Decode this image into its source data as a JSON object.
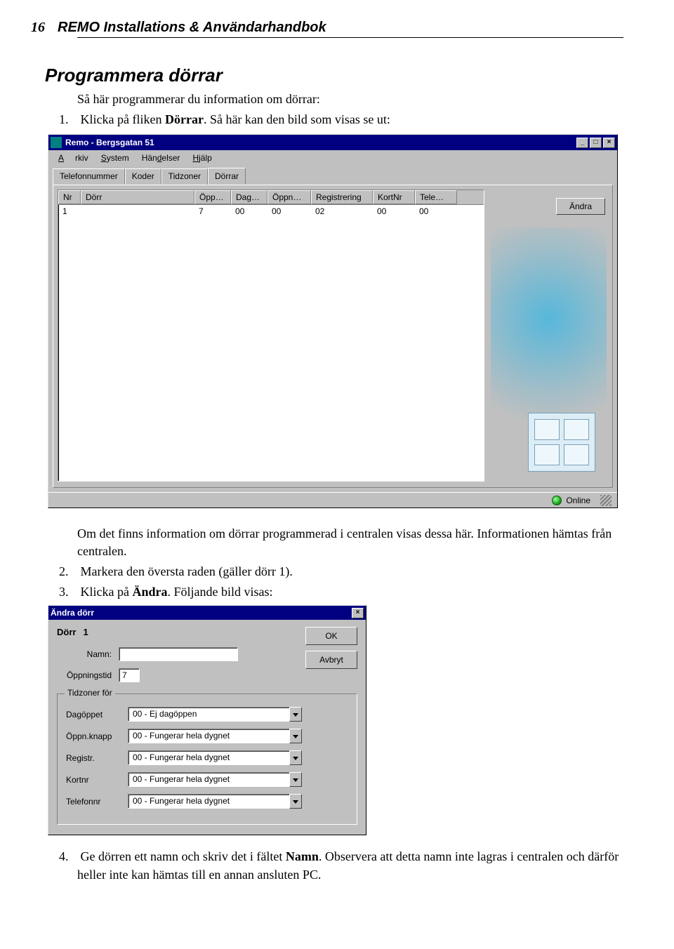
{
  "header": {
    "page_number": "16",
    "doc_title": "REMO Installations & Användarhandbok"
  },
  "section_title": "Programmera dörrar",
  "intro": "Så här programmerar du information om dörrar:",
  "step1_pre": "Klicka på fliken ",
  "step1_bold": "Dörrar",
  "step1_post": ". Så här kan den bild som visas se ut:",
  "win1": {
    "title": "Remo - Bergsgatan 51",
    "menu": {
      "arkiv": "Arkiv",
      "system": "System",
      "handelser": "Händelser",
      "hjalp": "Hjälp"
    },
    "tabs": {
      "telefonnummer": "Telefonnummer",
      "koder": "Koder",
      "tidzoner": "Tidzoner",
      "dorrar": "Dörrar"
    },
    "cols": {
      "nr": "Nr",
      "dorr": "Dörr",
      "opp": "Öpp…",
      "dag": "Dag…",
      "oppn": "Öppn…",
      "reg": "Registrering",
      "kort": "KortNr",
      "tele": "Tele…"
    },
    "row": {
      "nr": "1",
      "dorr": "",
      "opp": "7",
      "dag": "00",
      "oppn": "00",
      "reg": "02",
      "kort": "00",
      "tele": "00"
    },
    "andra": "Ändra",
    "status": "Online"
  },
  "between_text": "Om det finns information om dörrar programmerad i centralen visas dessa här. Informationen hämtas från centralen.",
  "step2": "Markera den översta raden (gäller dörr 1).",
  "step3_pre": "Klicka på ",
  "step3_bold": "Ändra",
  "step3_post": ". Följande bild visas:",
  "dlg": {
    "title": "Ändra dörr",
    "dorr_label": "Dörr",
    "dorr_num": "1",
    "ok": "OK",
    "avbryt": "Avbryt",
    "namn_label": "Namn:",
    "namn_value": "",
    "oppningstid_label": "Öppningstid",
    "oppningstid_value": "7",
    "group_title": "Tidzoner för",
    "rows": {
      "dagoppet": {
        "label": "Dagöppet",
        "value": "00 - Ej dagöppen"
      },
      "oppnknapp": {
        "label": "Öppn.knapp",
        "value": "00 - Fungerar hela dygnet"
      },
      "registr": {
        "label": "Registr.",
        "value": "00 - Fungerar hela dygnet"
      },
      "kortnr": {
        "label": "Kortnr",
        "value": "00 - Fungerar hela dygnet"
      },
      "telefonnr": {
        "label": "Telefonnr",
        "value": "00 - Fungerar hela dygnet"
      }
    }
  },
  "step4_pre": "Ge dörren ett namn och skriv det i fältet ",
  "step4_bold": "Namn",
  "step4_post": ". Observera att detta namn inte lagras i centralen och därför heller inte kan hämtas till en annan ansluten PC."
}
